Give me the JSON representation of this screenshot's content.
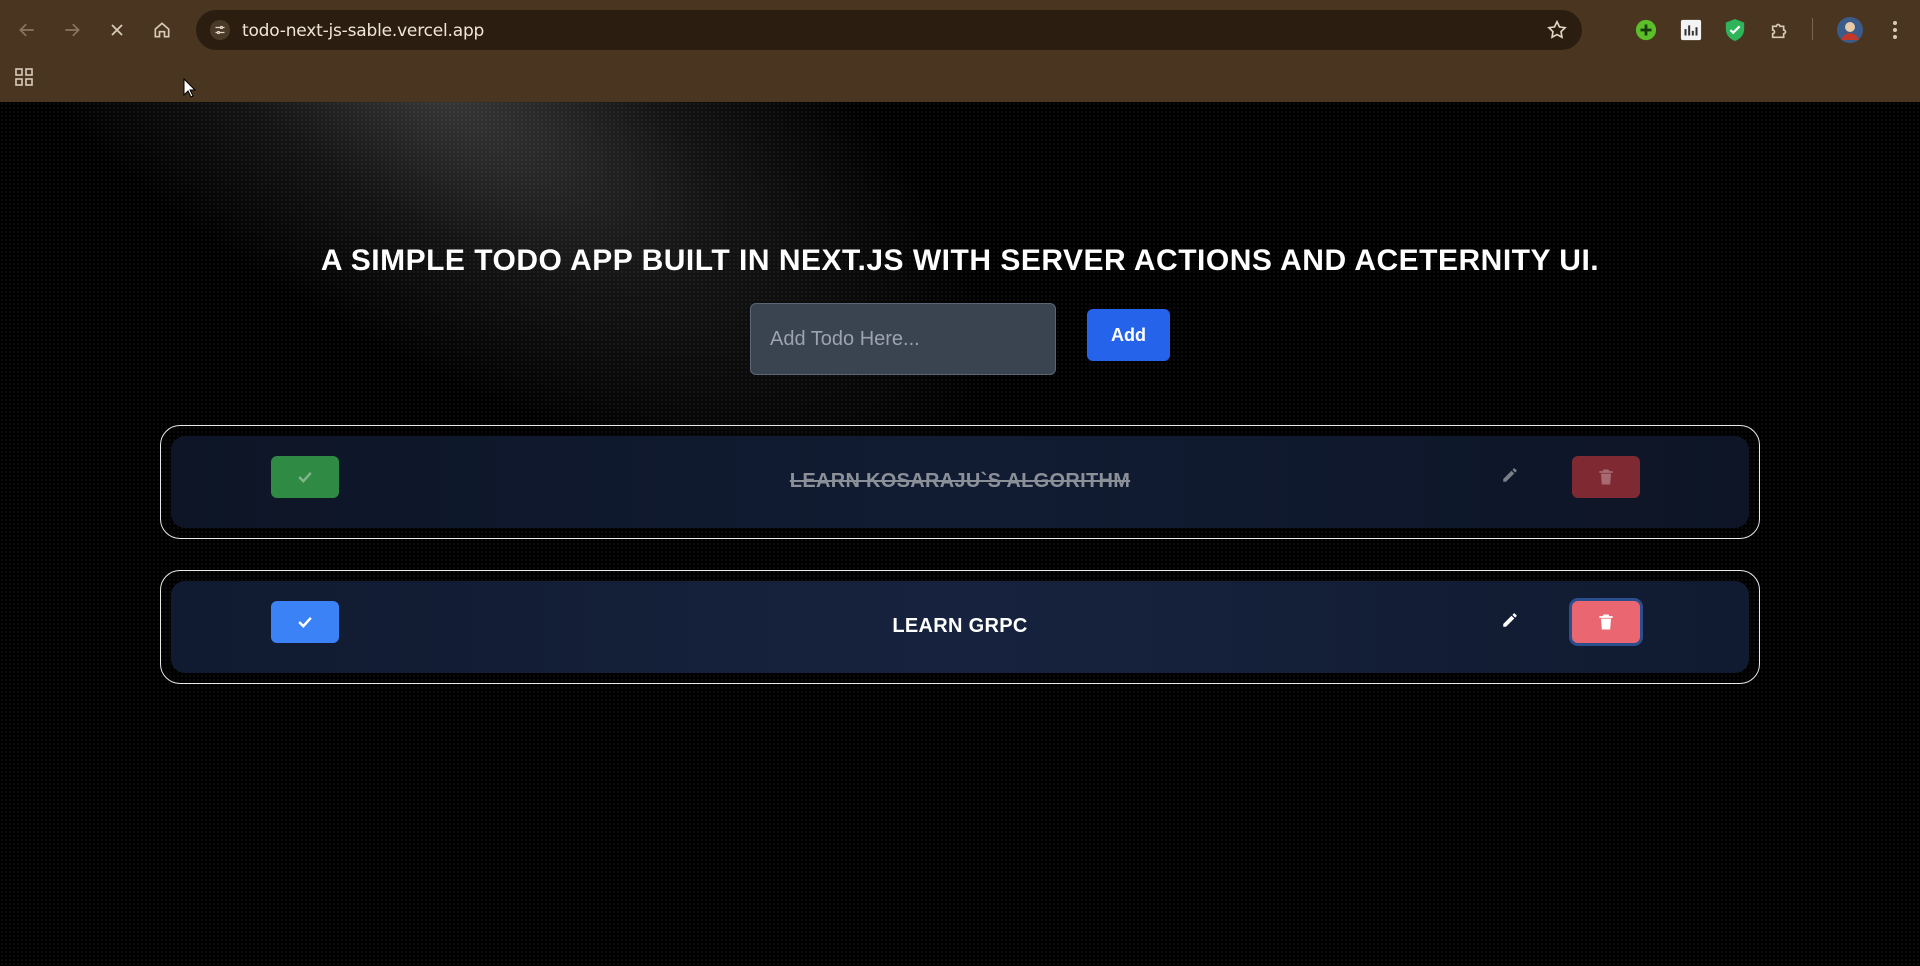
{
  "browser": {
    "url": "todo-next-js-sable.vercel.app",
    "icons": {
      "back": "arrow-left-icon",
      "forward": "arrow-right-icon",
      "stop": "close-icon",
      "home": "home-icon",
      "site_info": "tune-icon",
      "bookmark": "star-icon",
      "apps": "apps-grid-icon",
      "menu": "more-vertical-icon"
    },
    "extensions": [
      "plus-extension-icon",
      "chart-extension-icon",
      "shield-extension-icon",
      "puzzle-extensions-icon"
    ],
    "colors": {
      "frame": "#4a3620",
      "omnibox": "#2b1e10"
    }
  },
  "app": {
    "title": "A SIMPLE TODO APP BUILT IN NEXT.JS WITH SERVER ACTIONS AND ACETERNITY UI.",
    "input": {
      "placeholder": "Add Todo Here...",
      "value": ""
    },
    "add_label": "Add",
    "todos": [
      {
        "text": "LEARN KOSARAJU`S ALGORITHM",
        "completed": true
      },
      {
        "text": "LEARN GRPC",
        "completed": false
      }
    ],
    "colors": {
      "accent": "#2563eb",
      "check_done": "#2f8a43",
      "check_active": "#3b82f6",
      "delete_done": "#7f2a33",
      "delete_active": "#ea6670"
    }
  }
}
